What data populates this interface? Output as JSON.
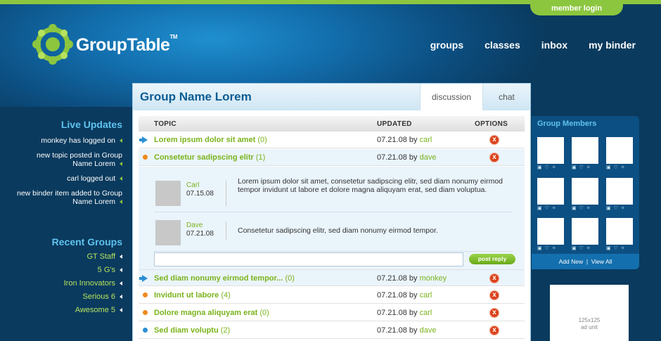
{
  "header": {
    "login_label": "member login",
    "logo_text": "GroupTable",
    "logo_tm": "TM",
    "nav": [
      "groups",
      "classes",
      "inbox",
      "my binder"
    ]
  },
  "left": {
    "live_updates_title": "Live Updates",
    "updates": [
      "monkey has logged on",
      "new topic posted in Group Name Lorem",
      "carl logged out",
      "new binder item added to Group Name Lorem"
    ],
    "recent_groups_title": "Recent Groups",
    "groups": [
      "GT Staff",
      "5 G's",
      "Iron Innovators",
      "Serious 6",
      "Awesome 5"
    ]
  },
  "panel": {
    "group_name": "Group Name Lorem",
    "tabs": [
      "discussion",
      "chat"
    ],
    "columns": [
      "TOPIC",
      "UPDATED",
      "OPTIONS"
    ],
    "rows": [
      {
        "topic": "Lorem ipsum dolor sit amet",
        "count": "(0)",
        "date": "07.21.08",
        "by": "by",
        "user": "carl",
        "bullet": "arrow",
        "color": "#2b8fd4"
      },
      {
        "topic": "Consetetur sadipscing elitr",
        "count": "(1)",
        "date": "07.21.08",
        "by": "by",
        "user": "dave",
        "bullet": "dot",
        "color": "#f08a1c"
      },
      {
        "topic": "Sed diam nonumy eirmod tempor...",
        "count": "(0)",
        "date": "07.21.08",
        "by": "by",
        "user": "monkey",
        "bullet": "arrow",
        "color": "#2b8fd4"
      },
      {
        "topic": "Invidunt ut labore",
        "count": "(4)",
        "date": "07.21.08",
        "by": "by",
        "user": "carl",
        "bullet": "dot",
        "color": "#f08a1c"
      },
      {
        "topic": "Dolore magna aliquyam erat",
        "count": "(0)",
        "date": "07.21.08",
        "by": "by",
        "user": "carl",
        "bullet": "dot",
        "color": "#f08a1c"
      },
      {
        "topic": "Sed diam voluptu",
        "count": "(2)",
        "date": "07.21.08",
        "by": "by",
        "user": "dave",
        "bullet": "dot",
        "color": "#2b8fd4"
      }
    ],
    "replies": [
      {
        "name": "Carl",
        "date": "07.15.08",
        "text": "Lorem ipsum dolor sit amet, consetetur sadipscing elitr, sed diam nonumy eirmod tempor invidunt ut labore et dolore magna aliquyam erat, sed diam voluptua."
      },
      {
        "name": "Dave",
        "date": "07.21.08",
        "text": "Consetetur sadipscing elitr, sed diam nonumy eirmod tempor."
      }
    ],
    "reply_value": "",
    "post_reply_label": "post reply",
    "delete_glyph": "x"
  },
  "members": {
    "title": "Group Members",
    "icons_text": "▣ ♡ ✧",
    "add_new": "Add New",
    "separator": "|",
    "view_all": "View All"
  },
  "ad": {
    "size": "125x125",
    "label": "ad unit"
  }
}
